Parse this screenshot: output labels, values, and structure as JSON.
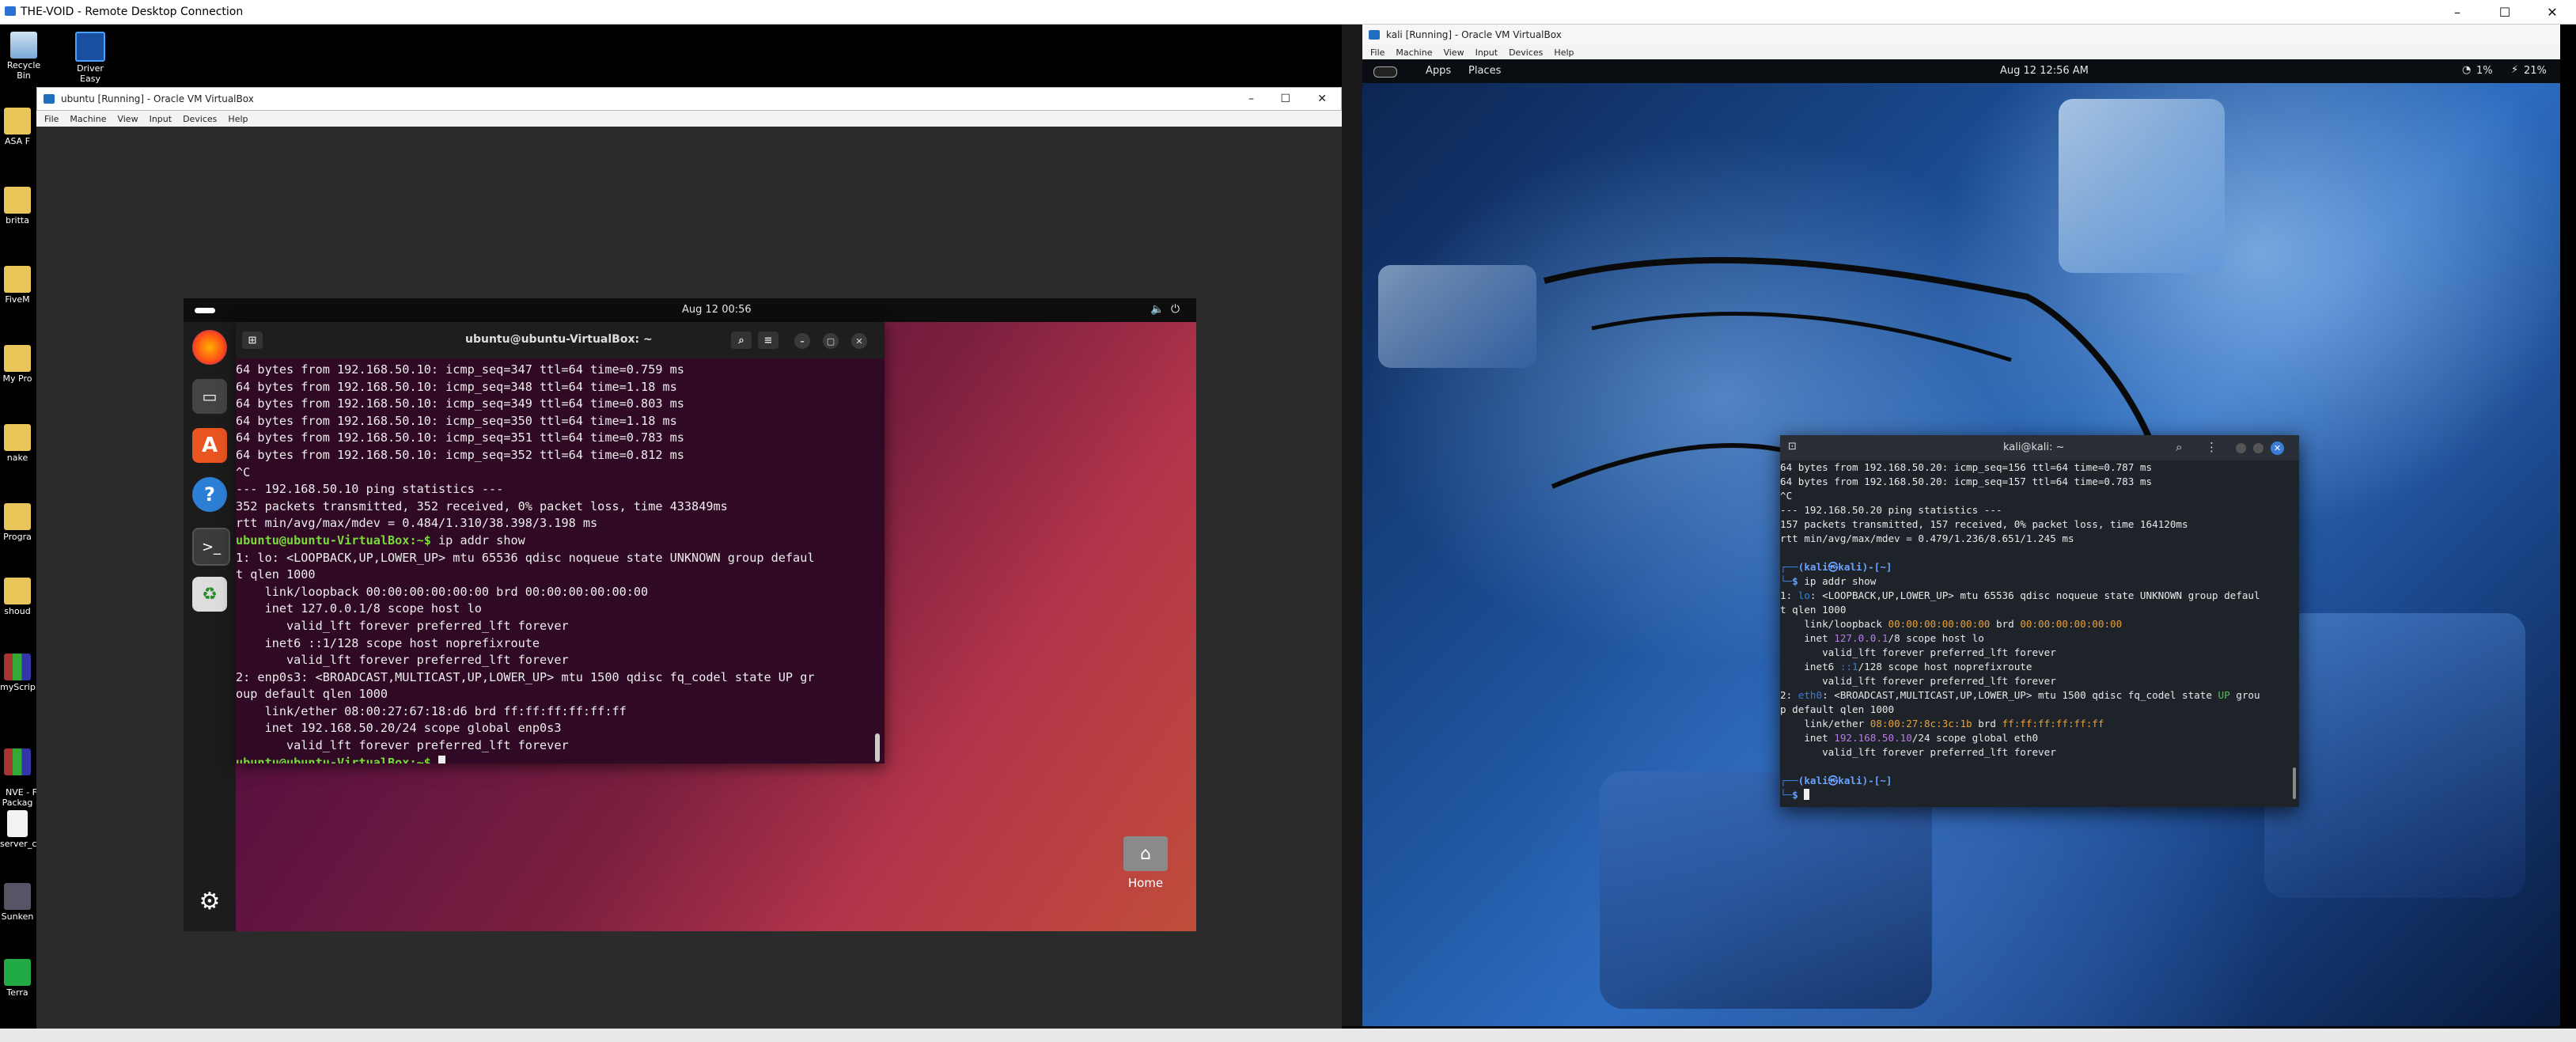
{
  "rdp": {
    "title": "THE-VOID - Remote Desktop Connection",
    "minimize": "–",
    "maximize": "☐",
    "close": "✕"
  },
  "desktop_icons": [
    {
      "label": "Recycle Bin",
      "icon": "recycle-bin-icon"
    },
    {
      "label": "Driver Easy",
      "icon": "driver-easy-icon"
    },
    {
      "label": "ASA F",
      "icon": "folder-icon"
    },
    {
      "label": "britta",
      "icon": "folder-icon"
    },
    {
      "label": "FiveM",
      "icon": "folder-icon"
    },
    {
      "label": "My Pro",
      "icon": "folder-icon"
    },
    {
      "label": "nake",
      "icon": "folder-icon"
    },
    {
      "label": "Progra",
      "icon": "folder-icon"
    },
    {
      "label": "shoud",
      "icon": "folder-icon"
    },
    {
      "label": "myScrip",
      "icon": "winrar-icon"
    },
    {
      "label": "NVE - F\nPackag",
      "icon": "winrar-icon"
    },
    {
      "label": "server_c",
      "icon": "document-icon"
    },
    {
      "label": "Sunken",
      "icon": "app-icon"
    },
    {
      "label": "Terra",
      "icon": "app-icon"
    }
  ],
  "ubuntu_vb": {
    "title": "ubuntu [Running] - Oracle VM VirtualBox",
    "menu": [
      "File",
      "Machine",
      "View",
      "Input",
      "Devices",
      "Help"
    ],
    "topbar_clock": "Aug 12  00:56",
    "dock_home_label": "Home",
    "terminal": {
      "title": "ubuntu@ubuntu-VirtualBox: ~",
      "lines": [
        "64 bytes from 192.168.50.10: icmp_seq=347 ttl=64 time=0.759 ms",
        "64 bytes from 192.168.50.10: icmp_seq=348 ttl=64 time=1.18 ms",
        "64 bytes from 192.168.50.10: icmp_seq=349 ttl=64 time=0.803 ms",
        "64 bytes from 192.168.50.10: icmp_seq=350 ttl=64 time=1.18 ms",
        "64 bytes from 192.168.50.10: icmp_seq=351 ttl=64 time=0.783 ms",
        "64 bytes from 192.168.50.10: icmp_seq=352 ttl=64 time=0.812 ms",
        "^C",
        "--- 192.168.50.10 ping statistics ---",
        "352 packets transmitted, 352 received, 0% packet loss, time 433849ms",
        "rtt min/avg/max/mdev = 0.484/1.310/38.398/3.198 ms"
      ],
      "prompt": "ubuntu@ubuntu-VirtualBox:~$",
      "command": " ip addr show",
      "output": [
        "1: lo: <LOOPBACK,UP,LOWER_UP> mtu 65536 qdisc noqueue state UNKNOWN group defaul",
        "t qlen 1000",
        "    link/loopback 00:00:00:00:00:00 brd 00:00:00:00:00:00",
        "    inet 127.0.0.1/8 scope host lo",
        "       valid_lft forever preferred_lft forever",
        "    inet6 ::1/128 scope host noprefixroute",
        "       valid_lft forever preferred_lft forever",
        "2: enp0s3: <BROADCAST,MULTICAST,UP,LOWER_UP> mtu 1500 qdisc fq_codel state UP gr",
        "oup default qlen 1000",
        "    link/ether 08:00:27:67:18:d6 brd ff:ff:ff:ff:ff:ff",
        "    inet 192.168.50.20/24 scope global enp0s3",
        "       valid_lft forever preferred_lft forever"
      ],
      "final_prompt": "ubuntu@ubuntu-VirtualBox:~$"
    }
  },
  "kali_vb": {
    "title": "kali [Running] - Oracle VM VirtualBox",
    "menu": [
      "File",
      "Machine",
      "View",
      "Input",
      "Devices",
      "Help"
    ],
    "panel": {
      "apps": "Apps",
      "places": "Places",
      "clock": "Aug 12  12:56 AM",
      "cpu": "1%",
      "battery": "21%"
    },
    "terminal": {
      "title": "kali@kali: ~",
      "lines": [
        "64 bytes from 192.168.50.20: icmp_seq=156 ttl=64 time=0.787 ms",
        "64 bytes from 192.168.50.20: icmp_seq=157 ttl=64 time=0.783 ms",
        "^C",
        "--- 192.168.50.20 ping statistics ---",
        "157 packets transmitted, 157 received, 0% packet loss, time 164120ms",
        "rtt min/avg/max/mdev = 0.479/1.236/8.651/1.245 ms"
      ],
      "prompt_user": "(kali㉿kali)-[~]",
      "command": "ip addr show",
      "output": {
        "l1a": "1: ",
        "l1b": "lo",
        "l1c": ": <LOOPBACK,UP,LOWER_UP> mtu 65536 qdisc noqueue state UNKNOWN group defaul",
        "l2": "t qlen 1000",
        "l3a": "    link/loopback ",
        "l3b": "00:00:00:00:00:00",
        "l3c": " brd ",
        "l3d": "00:00:00:00:00:00",
        "l4a": "    inet ",
        "l4b": "127.0.0.1",
        "l4c": "/8 scope host lo",
        "l5": "       valid_lft forever preferred_lft forever",
        "l6a": "    inet6 ",
        "l6b": "::1",
        "l6c": "/128 scope host noprefixroute",
        "l7": "       valid_lft forever preferred_lft forever",
        "l8a": "2: ",
        "l8b": "eth0",
        "l8c": ": <BROADCAST,MULTICAST,UP,LOWER_UP> mtu 1500 qdisc fq_codel state ",
        "l8d": "UP",
        "l8e": " grou",
        "l9": "p default qlen 1000",
        "l10a": "    link/ether ",
        "l10b": "08:00:27:8c:3c:1b",
        "l10c": " brd ",
        "l10d": "ff:ff:ff:ff:ff:ff",
        "l11a": "    inet ",
        "l11b": "192.168.50.10",
        "l11c": "/24 scope global eth0",
        "l12": "       valid_lft forever preferred_lft forever"
      }
    }
  }
}
